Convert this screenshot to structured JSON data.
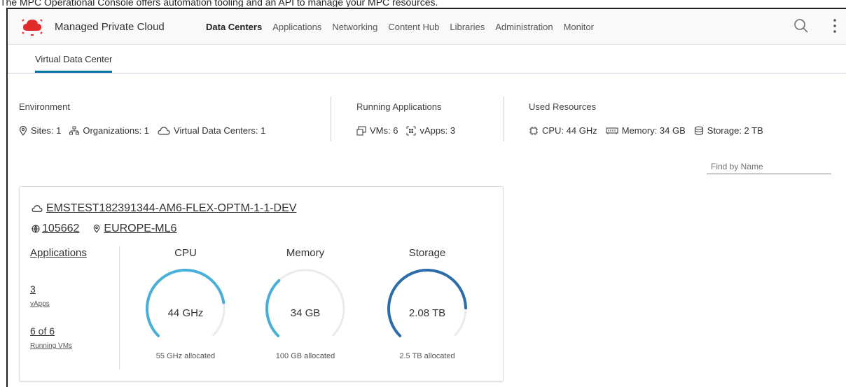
{
  "caption": "The MPC Operational Console offers automation tooling and an API to manage your MPC resources.",
  "app": {
    "title": "Managed Private Cloud"
  },
  "nav": [
    {
      "label": "Data Centers",
      "active": true
    },
    {
      "label": "Applications"
    },
    {
      "label": "Networking"
    },
    {
      "label": "Content Hub"
    },
    {
      "label": "Libraries"
    },
    {
      "label": "Administration"
    },
    {
      "label": "Monitor"
    }
  ],
  "subnav": {
    "tab": "Virtual Data Center"
  },
  "summary": {
    "environment": {
      "label": "Environment",
      "sites": "Sites: 1",
      "organizations": "Organizations: 1",
      "vdcs": "Virtual Data Centers: 1"
    },
    "running": {
      "label": "Running Applications",
      "vms": "VMs: 6",
      "vapps": "vApps: 3"
    },
    "resources": {
      "label": "Used Resources",
      "cpu": "CPU: 44 GHz",
      "memory": "Memory: 34 GB",
      "storage": "Storage: 2 TB"
    }
  },
  "search": {
    "placeholder": "Find by Name"
  },
  "card": {
    "name": "EMSTEST182391344-AM6-FLEX-OPTM-1-1-DEV",
    "id": "105662",
    "location": "EUROPE-ML6",
    "applications_label": "Applications",
    "vapps_count": "3",
    "vapps_label": "vApps",
    "vms_count": "6 of 6",
    "vms_label": "Running VMs",
    "gauges": [
      {
        "title": "CPU",
        "value": "44 GHz",
        "allocated": "55 GHz allocated",
        "fraction": 0.8,
        "color": "#49afd9"
      },
      {
        "title": "Memory",
        "value": "34 GB",
        "allocated": "100 GB allocated",
        "fraction": 0.34,
        "color": "#49afd9"
      },
      {
        "title": "Storage",
        "value": "2.08 TB",
        "allocated": "2.5 TB allocated",
        "fraction": 0.83,
        "color": "#2b6ca9"
      }
    ]
  },
  "colors": {
    "accent": "#0072a3",
    "logo": "#e12b2b",
    "gauge_track": "#ebebeb"
  }
}
